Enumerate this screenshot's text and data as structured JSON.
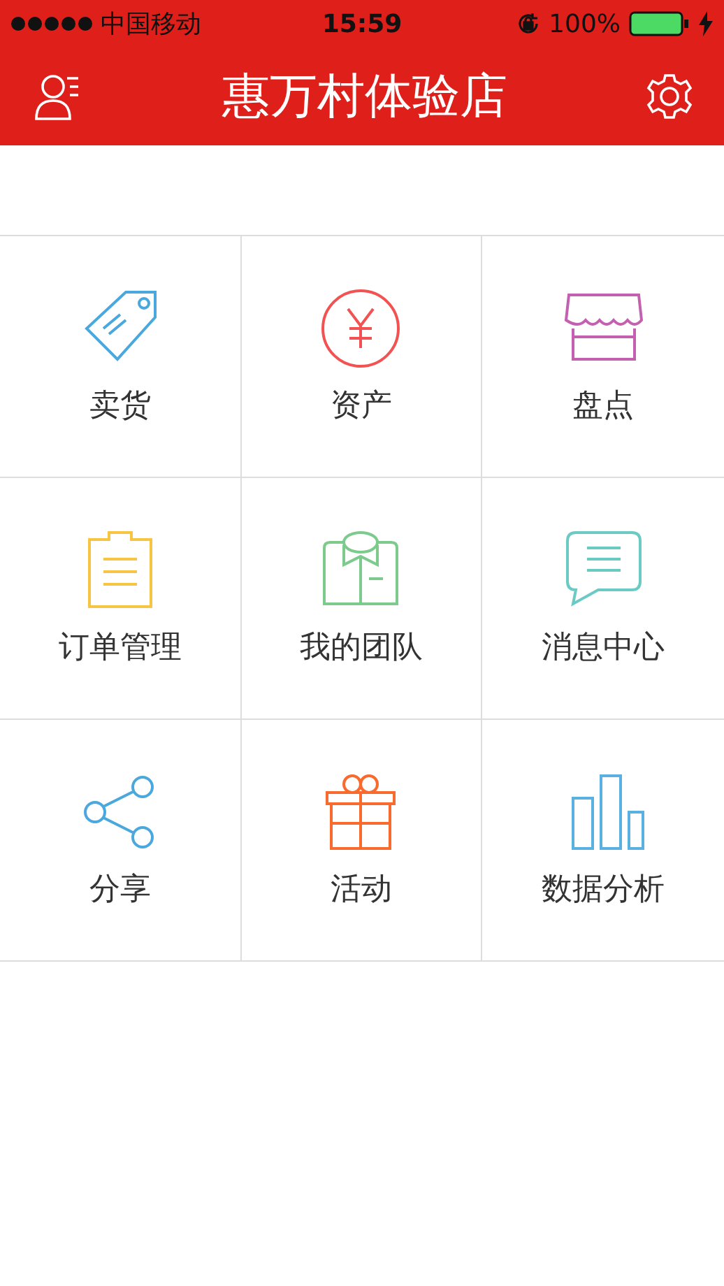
{
  "status_bar": {
    "carrier": "中国移动",
    "time": "15:59",
    "battery": "100%"
  },
  "header": {
    "title": "惠万村体验店"
  },
  "grid": [
    {
      "kind": "tag",
      "label": "卖货",
      "color": "#4aa8de"
    },
    {
      "kind": "yen",
      "label": "资产",
      "color": "#f25252"
    },
    {
      "kind": "store",
      "label": "盘点",
      "color": "#c460b0"
    },
    {
      "kind": "clipboard",
      "label": "订单管理",
      "color": "#f8c444"
    },
    {
      "kind": "shirt",
      "label": "我的团队",
      "color": "#7ccb8c"
    },
    {
      "kind": "chat",
      "label": "消息中心",
      "color": "#6ccac4"
    },
    {
      "kind": "share",
      "label": "分享",
      "color": "#4aa8de"
    },
    {
      "kind": "gift",
      "label": "活动",
      "color": "#f96a2f"
    },
    {
      "kind": "bars",
      "label": "数据分析",
      "color": "#5ab0e0"
    }
  ]
}
